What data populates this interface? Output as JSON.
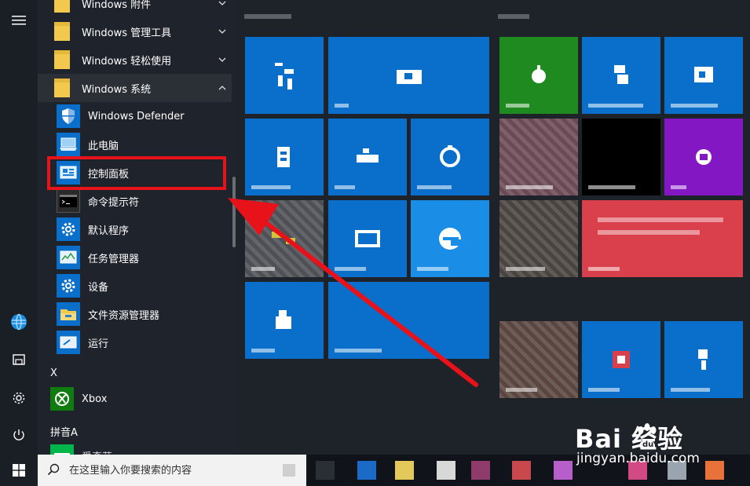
{
  "app_list": {
    "folders_top": [
      {
        "label": "Windows 附件",
        "state": "collapsed"
      },
      {
        "label": "Windows 管理工具",
        "state": "collapsed"
      },
      {
        "label": "Windows 轻松使用",
        "state": "collapsed"
      },
      {
        "label": "Windows 系统",
        "state": "expanded"
      }
    ],
    "windows_system_items": [
      {
        "label": "Windows Defender",
        "icon": "shield-icon"
      },
      {
        "label": "此电脑",
        "icon": "computer-icon"
      },
      {
        "label": "控制面板",
        "icon": "control-panel-icon"
      },
      {
        "label": "命令提示符",
        "icon": "cmd-icon"
      },
      {
        "label": "默认程序",
        "icon": "gear-icon"
      },
      {
        "label": "任务管理器",
        "icon": "task-manager-icon"
      },
      {
        "label": "设备",
        "icon": "gear-icon"
      },
      {
        "label": "文件资源管理器",
        "icon": "folder-explorer-icon"
      },
      {
        "label": "运行",
        "icon": "run-icon"
      }
    ],
    "group_x": {
      "letter": "X",
      "items": [
        {
          "label": "Xbox",
          "icon": "xbox-icon"
        }
      ]
    },
    "group_pinyin_a": {
      "letter": "拼音A",
      "items": [
        {
          "label": "爱奇艺",
          "icon": "iqiyi-icon"
        }
      ]
    },
    "highlighted_item": "控制面板"
  },
  "taskbar": {
    "search_placeholder": "在这里输入你要搜索的内容"
  },
  "watermark": {
    "brand": "Bai  经验",
    "url": "jingyan.baidu.com"
  },
  "colors": {
    "tile_blue": "#0a6fcb",
    "tile_green": "#1f8a1f",
    "tile_purple": "#8417c4",
    "tile_red": "#d9404b",
    "highlight_red": "#e8121a"
  }
}
